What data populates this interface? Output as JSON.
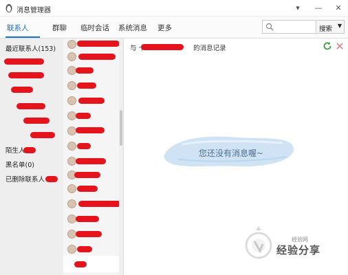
{
  "window": {
    "title": "消息管理器",
    "menu_glyph": "▾",
    "minimize_glyph": "—",
    "close_glyph": "✕"
  },
  "tabs": [
    {
      "label": "联系人",
      "active": true
    },
    {
      "label": "群聊",
      "active": false
    },
    {
      "label": "临时会话",
      "active": false
    },
    {
      "label": "系统消息",
      "active": false
    },
    {
      "label": "更多",
      "active": false
    }
  ],
  "search": {
    "placeholder": "",
    "button_label": "搜索",
    "dropdown_glyph": "▼"
  },
  "left_nav": {
    "recent_contacts": "最近联系人(153)",
    "strangers": "陌生人",
    "blacklist": "黑名单(0)",
    "deleted_contacts": "已删除联系人"
  },
  "chat": {
    "header_prefix": "与",
    "header_partial": "十",
    "header_suffix": "的消息记录",
    "empty_message": "您还没有消息喔~"
  },
  "watermark": {
    "small_text": "经验网",
    "brand_text": "经验分享"
  },
  "icons": {
    "title": "penguin-icon",
    "search": "search-icon",
    "refresh": "refresh-icon",
    "close_chat": "close-icon",
    "avatar": "avatar-icon"
  },
  "colors": {
    "accent": "#1a73c9",
    "redaction": "#e5141c",
    "left_panel": "#eeeeee",
    "empty_cloud": "#cfe3f5"
  }
}
